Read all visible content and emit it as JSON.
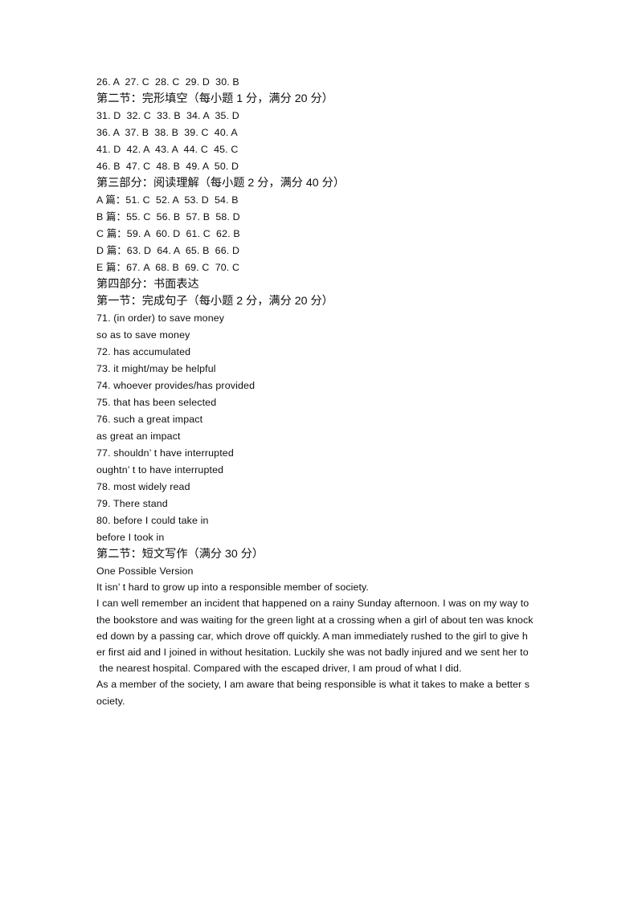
{
  "document": {
    "type": "answer-key",
    "background_color": "#ffffff",
    "text_color": "#0d0d0d"
  },
  "sections": {
    "multiple_choice_tail": {
      "line": "26. A  27. C  28. C  29. D  30. B"
    },
    "cloze": {
      "heading": "第二节：完形填空（每小题 1 分，满分 20 分）",
      "lines": [
        "31. D  32. C  33. B  34. A  35. D",
        "36. A  37. B  38. B  39. C  40. A",
        "41. D  42. A  43. A  44. C  45. C",
        "46. B  47. C  48. B  49. A  50. D"
      ]
    },
    "reading": {
      "heading": "第三部分：阅读理解（每小题 2 分，满分 40 分）",
      "lines": [
        "A 篇：51. C  52. A  53. D  54. B",
        "B 篇：55. C  56. B  57. B  58. D",
        "C 篇：59. A  60. D  61. C  62. B",
        "D 篇：63. D  64. A  65. B  66. D",
        "E 篇：67. A  68. B  69. C  70. C"
      ]
    },
    "writing": {
      "part_heading": "第四部分：书面表达",
      "sentence_completion": {
        "heading": "第一节：完成句子（每小题 2 分，满分 20 分）",
        "lines": [
          "71. (in order) to save money",
          "so as to save money",
          "72. has accumulated",
          "73. it might/may be helpful",
          "74. whoever provides/has provided",
          "75. that has been selected",
          "76. such a great impact",
          "as great an impact",
          "77. shouldn’ t have interrupted",
          "oughtn’ t to have interrupted",
          "78. most widely read",
          "79. There stand",
          "80. before I could take in",
          "before I took in"
        ]
      },
      "essay": {
        "heading": "第二节：短文写作（满分 30 分）",
        "label": "One Possible Version",
        "lines": [
          "It isn’ t hard to grow up into a responsible member of society.",
          "I can well remember an incident that happened on a rainy Sunday afternoon. I was on my way to",
          "the bookstore and was waiting for the green light at a crossing when a girl of about ten was knock",
          "ed down by a passing car, which drove off quickly. A man immediately rushed to the girl to give h",
          "er first aid and I joined in without hesitation. Luckily she was not badly injured and we sent her to",
          " the nearest hospital. Compared with the escaped driver, I am proud of what I did.",
          "As a member of the society, I am aware that being responsible is what it takes to make a better s",
          "ociety."
        ]
      }
    }
  }
}
